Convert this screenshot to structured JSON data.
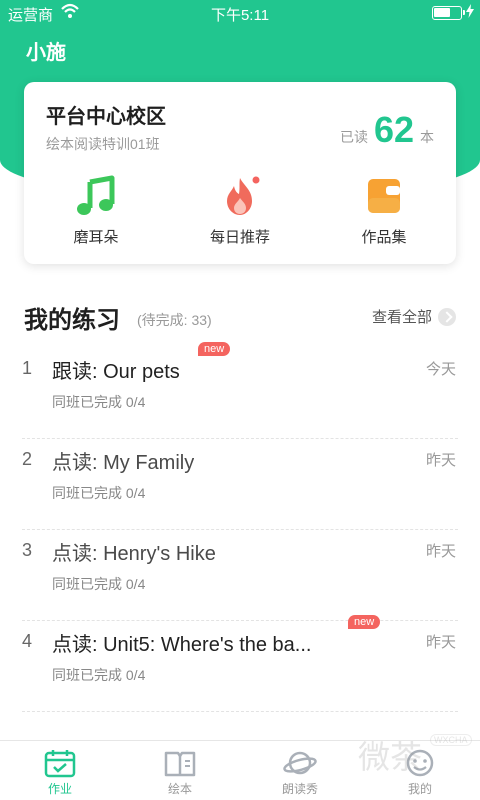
{
  "statusbar": {
    "carrier": "运营商",
    "time": "下午5:11"
  },
  "app": {
    "title": "小施"
  },
  "card": {
    "campus": "平台中心校区",
    "class_name": "绘本阅读特训01班",
    "read_label": "已读",
    "read_count": "62",
    "read_unit": "本",
    "features": [
      {
        "label": "磨耳朵",
        "icon": "music-note-icon"
      },
      {
        "label": "每日推荐",
        "icon": "flame-icon"
      },
      {
        "label": "作品集",
        "icon": "wallet-icon"
      }
    ]
  },
  "practice": {
    "title": "我的练习",
    "subtitle": "(待完成: 33)",
    "view_all": "查看全部",
    "items": [
      {
        "index": "1",
        "title": "跟读: Our pets",
        "progress": "同班已完成 0/4",
        "date": "今天",
        "badge": "new"
      },
      {
        "index": "2",
        "title": "点读: My Family",
        "progress": "同班已完成 0/4",
        "date": "昨天",
        "badge": ""
      },
      {
        "index": "3",
        "title": "点读: Henry's Hike",
        "progress": "同班已完成 0/4",
        "date": "昨天",
        "badge": ""
      },
      {
        "index": "4",
        "title": "点读: Unit5: Where's the ba...",
        "progress": "同班已完成 0/4",
        "date": "昨天",
        "badge": "new"
      }
    ]
  },
  "tabbar": {
    "tabs": [
      {
        "label": "作业",
        "icon": "calendar-check-icon",
        "active": true
      },
      {
        "label": "绘本",
        "icon": "book-icon",
        "active": false
      },
      {
        "label": "朗读秀",
        "icon": "planet-icon",
        "active": false
      },
      {
        "label": "我的",
        "icon": "smiley-icon",
        "active": false
      }
    ]
  },
  "watermark": {
    "text": "微茶",
    "tag": "WXCHA"
  },
  "colors": {
    "accent": "#21c68f",
    "badge": "#f4645f",
    "music": "#3cc75a",
    "flame": "#f06b5c",
    "wallet": "#f7a233"
  }
}
